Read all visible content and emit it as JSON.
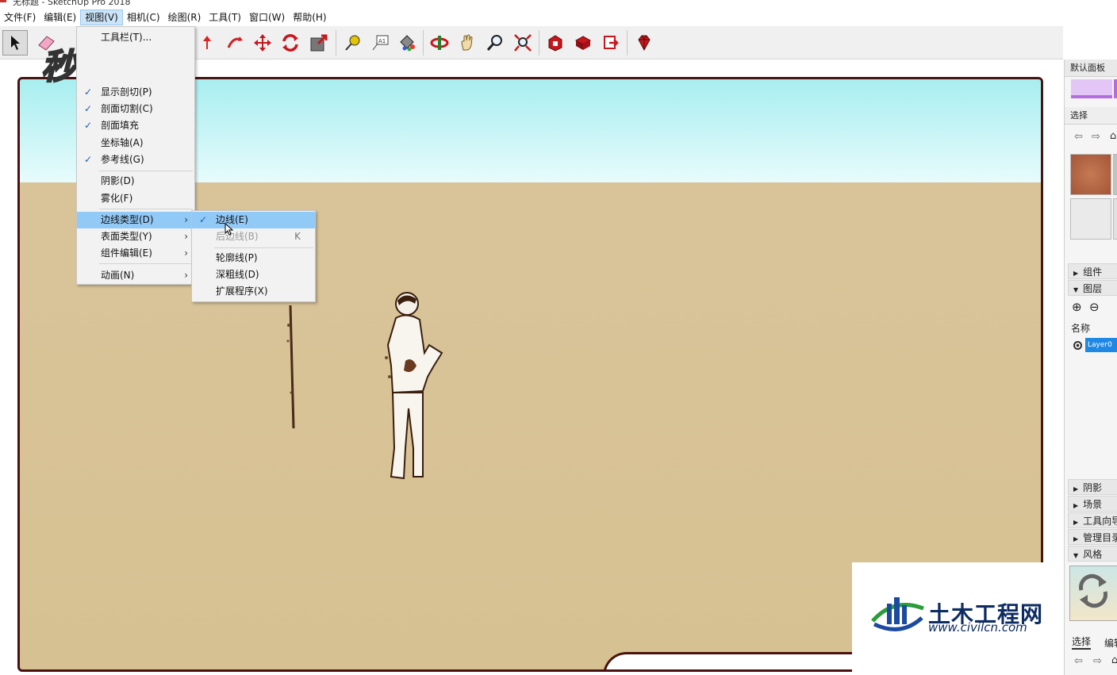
{
  "window": {
    "title": "无标题 - SketchUp Pro 2018"
  },
  "menubar": {
    "items": [
      {
        "label": "文件(F)"
      },
      {
        "label": "编辑(E)"
      },
      {
        "label": "视图(V)",
        "active": true
      },
      {
        "label": "相机(C)"
      },
      {
        "label": "绘图(R)"
      },
      {
        "label": "工具(T)"
      },
      {
        "label": "窗口(W)"
      },
      {
        "label": "帮助(H)"
      }
    ]
  },
  "view_menu": {
    "items": [
      {
        "label": "工具栏(T)...",
        "checked": false
      },
      {
        "label": "显示剖切(P)",
        "checked": true
      },
      {
        "label": "剖面切割(C)",
        "checked": true
      },
      {
        "label": "剖面填充",
        "checked": true
      },
      {
        "label": "坐标轴(A)",
        "checked": false
      },
      {
        "label": "参考线(G)",
        "checked": true
      },
      {
        "label": "阴影(D)",
        "checked": false
      },
      {
        "label": "雾化(F)",
        "checked": false
      },
      {
        "label": "边线类型(D)",
        "submenu": true,
        "highlighted": true
      },
      {
        "label": "表面类型(Y)",
        "submenu": true
      },
      {
        "label": "组件编辑(E)",
        "submenu": true
      },
      {
        "label": "动画(N)",
        "submenu": true
      }
    ]
  },
  "edge_style_submenu": {
    "items": [
      {
        "label": "边线(E)",
        "checked": true,
        "highlighted": true
      },
      {
        "label": "后边线(B)",
        "shortcut": "K",
        "disabled": true
      },
      {
        "label": "轮廓线(P)"
      },
      {
        "label": "深粗线(D)"
      },
      {
        "label": "扩展程序(X)"
      }
    ]
  },
  "tray": {
    "title": "默认面板",
    "select_label": "选择",
    "sections": {
      "components": "组件",
      "layers": "图层",
      "shadows": "阴影",
      "scenes": "场景",
      "instructor": "工具向导",
      "manage": "管理目录",
      "styles": "风格"
    },
    "layers": {
      "name_header": "名称",
      "active_layer": "Layer0"
    },
    "bottom_tabs": [
      "选择",
      "编辑"
    ]
  },
  "watermarks": {
    "video_logo": "秒懂视频",
    "site_cn": "土木工程网",
    "site_url": "www.civilcn.com"
  },
  "colors": {
    "sky": "#c7f5f7",
    "ground": "#d8c398",
    "viewport_border": "#4a1210",
    "menu_highlight": "#91c9f7",
    "layer_highlight": "#1e88e5"
  }
}
